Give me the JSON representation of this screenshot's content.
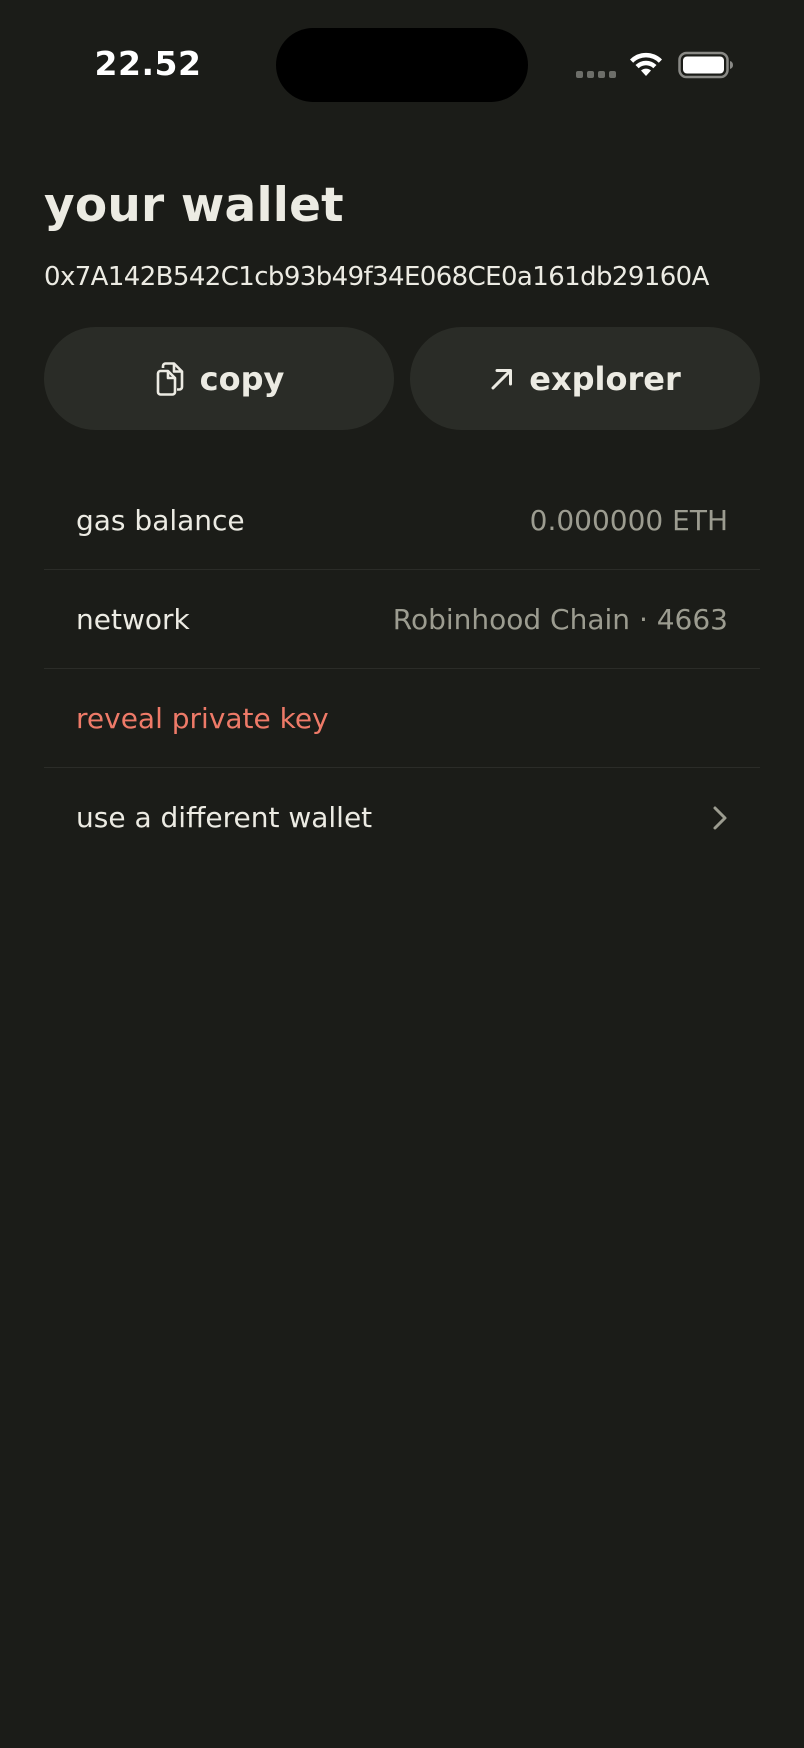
{
  "status_bar": {
    "time": "22.52"
  },
  "header": {
    "title": "your wallet",
    "address": "0x7A142B542C1cb93b49f34E068CE0a161db29160A"
  },
  "actions": {
    "copy_label": "copy",
    "copy_icon": "copy-icon",
    "explorer_label": "explorer",
    "explorer_icon": "arrow-up-right-icon"
  },
  "details": {
    "gas_balance_label": "gas balance",
    "gas_balance_value": "0.000000 ETH",
    "network_label": "network",
    "network_value": "Robinhood Chain · 4663",
    "reveal_key_label": "reveal private key",
    "switch_wallet_label": "use a different wallet"
  },
  "colors": {
    "background": "#1b1c18",
    "button_bg": "#2a2c27",
    "text_primary": "#ecebe3",
    "text_secondary": "#9c9c90",
    "danger": "#ee7a68",
    "divider": "#2b2c28"
  }
}
